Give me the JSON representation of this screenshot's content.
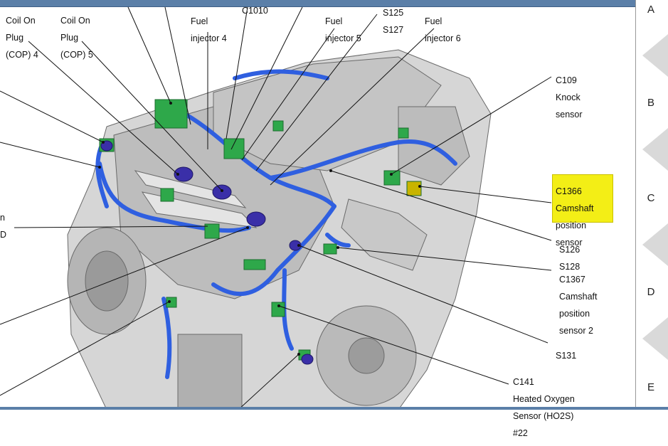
{
  "callouts": {
    "cop4": [
      "Coil On",
      "Plug",
      "(COP) 4"
    ],
    "cop5": [
      "Coil On",
      "Plug",
      "(COP) 5"
    ],
    "inj4": [
      "Fuel",
      "injector 4"
    ],
    "c1010": "C1010",
    "inj5": [
      "Fuel",
      "injector 5"
    ],
    "s125": [
      "S125",
      "S127"
    ],
    "inj6": [
      "Fuel",
      "injector 6"
    ],
    "c109": [
      "C109",
      "Knock",
      "sensor"
    ],
    "c1366": [
      "C1366",
      "Camshaft",
      "position",
      "sensor"
    ],
    "s126": [
      "S126",
      "S128"
    ],
    "c1367": [
      "C1367",
      "Camshaft",
      "position",
      "sensor 2"
    ],
    "s131": "S131",
    "c141": [
      "C141",
      "Heated Oxygen",
      "Sensor (HO2S)",
      "#22"
    ],
    "left_partial": [
      "n",
      "D"
    ]
  },
  "rows": [
    "A",
    "B",
    "C",
    "D",
    "E"
  ],
  "highlight_color": "#f3ee16",
  "harness_color": "#2f5fe0",
  "connector_color": "#2ea84a",
  "coil_color": "#3a2fa8"
}
